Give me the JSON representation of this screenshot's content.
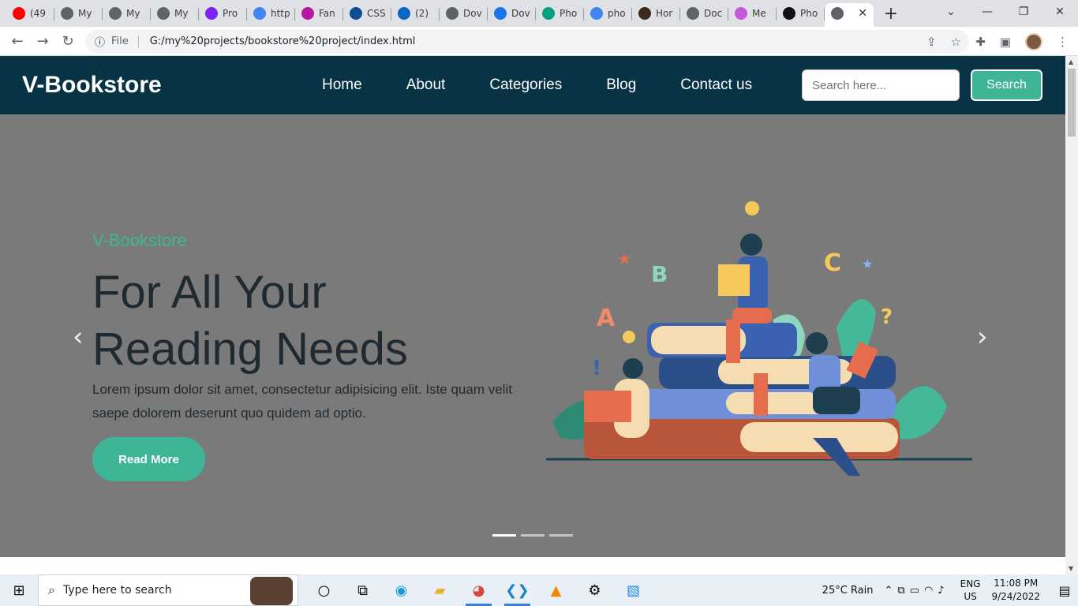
{
  "browser": {
    "tabs": [
      {
        "label": "(49",
        "icon": "youtube-icon",
        "color": "#ff0000"
      },
      {
        "label": "My",
        "icon": "globe-icon",
        "color": "#5f6368"
      },
      {
        "label": "My",
        "icon": "globe-icon",
        "color": "#5f6368"
      },
      {
        "label": "My",
        "icon": "globe-icon",
        "color": "#5f6368"
      },
      {
        "label": "Pro",
        "icon": "bootstrap-icon",
        "color": "#7b23f5"
      },
      {
        "label": "http",
        "icon": "google-icon",
        "color": "#4285f4"
      },
      {
        "label": "Fan",
        "icon": "blob-icon",
        "color": "#b5179e"
      },
      {
        "label": "CSS",
        "icon": "circle-icon",
        "color": "#0e4d92"
      },
      {
        "label": "(2)",
        "icon": "linkedin-icon",
        "color": "#0a66c2"
      },
      {
        "label": "Dov",
        "icon": "globe-icon",
        "color": "#5f6368"
      },
      {
        "label": "Dov",
        "icon": "download-icon",
        "color": "#1a73e8"
      },
      {
        "label": "Pho",
        "icon": "pexels-icon",
        "color": "#05a081"
      },
      {
        "label": "pho",
        "icon": "google-icon",
        "color": "#4285f4"
      },
      {
        "label": "Hor",
        "icon": "avatar-icon",
        "color": "#3b2a20"
      },
      {
        "label": "Doc",
        "icon": "globe-icon",
        "color": "#5f6368"
      },
      {
        "label": "Me",
        "icon": "ms-icon",
        "color": "#c55ad9"
      },
      {
        "label": "Pho",
        "icon": "unsplash-icon",
        "color": "#111111"
      }
    ],
    "active_tab": {
      "icon": "globe-icon",
      "close": "✕"
    },
    "new_tab": "+",
    "address": {
      "scheme_label": "File",
      "url": "G:/my%20projects/bookstore%20project/index.html"
    }
  },
  "site": {
    "logo": "V-Bookstore",
    "menu": [
      "Home",
      "About",
      "Categories",
      "Blog",
      "Contact us"
    ],
    "search_placeholder": "Search here...",
    "search_button": "Search"
  },
  "hero": {
    "eyebrow": "V-Bookstore",
    "title": "For All Your Reading Needs",
    "description": "Lorem ipsum dolor sit amet, consectetur adipisicing elit. Iste quam velit saepe dolorem deserunt quo quidem ad optio.",
    "cta": "Read More",
    "slides": 3,
    "active_slide": 0
  },
  "taskbar": {
    "search_placeholder": "Type here to search",
    "weather": "25°C  Rain",
    "lang_top": "ENG",
    "lang_bottom": "US",
    "time": "11:08 PM",
    "date": "9/24/2022"
  },
  "colors": {
    "header_bg": "#083344",
    "accent": "#3fb597",
    "hero_bg": "#7a7a7a"
  }
}
